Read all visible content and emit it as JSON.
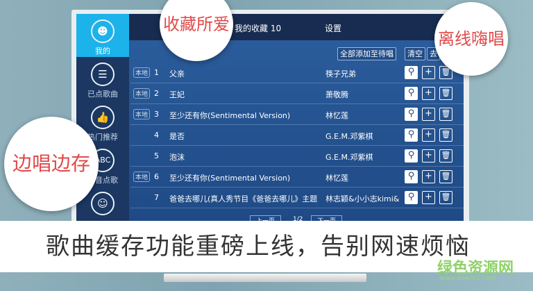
{
  "sidebar": {
    "items": [
      {
        "label": "我的",
        "icon": "user-icon"
      },
      {
        "label": "已点歌曲",
        "icon": "list-icon"
      },
      {
        "label": "热门推荐",
        "icon": "thumbs-up-icon"
      },
      {
        "label": "拼音点歌",
        "icon": "abc-icon"
      },
      {
        "label": "",
        "icon": "singer-icon"
      }
    ]
  },
  "header": {
    "tab_favorites": "我的收藏 10",
    "tab_settings": "设置"
  },
  "toolbar": {
    "add_all": "全部添加至待唱",
    "clear": "清空",
    "go": "去"
  },
  "songs": [
    {
      "badge": "本地",
      "num": "1",
      "title": "父亲",
      "artist": "筷子兄弟"
    },
    {
      "badge": "本地",
      "num": "2",
      "title": "王妃",
      "artist": "萧敬腾"
    },
    {
      "badge": "本地",
      "num": "3",
      "title": "至少还有你(Sentimental Version)",
      "artist": "林忆莲"
    },
    {
      "badge": "",
      "num": "4",
      "title": "是否",
      "artist": "G.E.M.邓紫棋"
    },
    {
      "badge": "",
      "num": "5",
      "title": "泡沫",
      "artist": "G.E.M.邓紫棋"
    },
    {
      "badge": "本地",
      "num": "6",
      "title": "至少还有你(Sentimental Version)",
      "artist": "林忆莲"
    },
    {
      "badge": "",
      "num": "7",
      "title": "爸爸去哪儿(真人秀节目《爸爸去哪儿》主题",
      "artist": "林志颖&小小志kimi&"
    }
  ],
  "pager": {
    "prev": "上一页",
    "page": "1/2",
    "next": "下一页"
  },
  "callouts": {
    "favorites": "收藏所爱",
    "offline": "离线嗨唱",
    "cache": "边唱边存"
  },
  "banner": "歌曲缓存功能重磅上线，告别网速烦恼",
  "watermark": {
    "name": "绿色资源网",
    "url": "www.downcc.com"
  }
}
